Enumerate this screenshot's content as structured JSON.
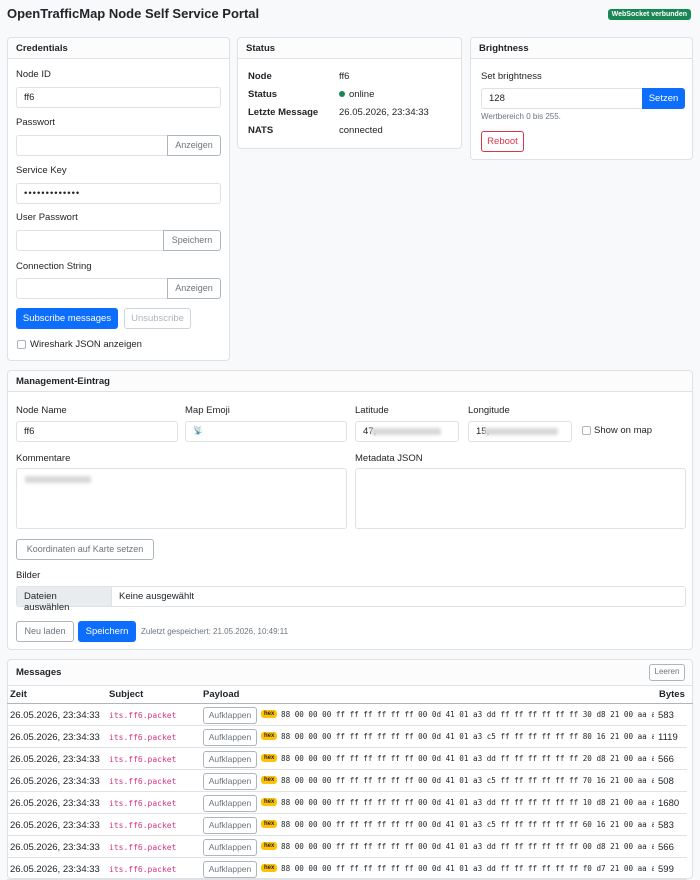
{
  "app": {
    "title": "OpenTrafficMap Node Self Service Portal",
    "ws_badge": "WebSocket verbunden"
  },
  "credentials": {
    "header": "Credentials",
    "node_id_label": "Node ID",
    "node_id_value": "ff6",
    "password_label": "Passwort",
    "password_toggle": "Anzeigen",
    "service_key_label": "Service Key",
    "service_key_value": "•••••••••••••",
    "user_password_label": "User Passwort",
    "user_password_save": "Speichern",
    "connection_string_label": "Connection String",
    "connection_string_toggle": "Anzeigen",
    "subscribe_label": "Subscribe messages",
    "unsubscribe_label": "Unsubscribe",
    "wireshark_label": "Wireshark JSON anzeigen"
  },
  "status": {
    "header": "Status",
    "rows": [
      {
        "key": "Node",
        "value": "ff6"
      },
      {
        "key": "Status",
        "value": "online"
      },
      {
        "key": "Letzte Message",
        "value": "26.05.2026, 23:34:33"
      },
      {
        "key": "NATS",
        "value": "connected"
      }
    ],
    "online_color": "#198754"
  },
  "brightness": {
    "header": "Brightness",
    "set_label": "Set brightness",
    "value": "128",
    "set_button": "Setzen",
    "hint": "Wertbereich 0 bis 255.",
    "reboot_button": "Reboot"
  },
  "management": {
    "header": "Management-Eintrag",
    "node_name_label": "Node Name",
    "node_name_value": "ff6",
    "emoji_label": "Map Emoji",
    "emoji_value": "📡",
    "lat_label": "Latitude",
    "lat_value": "47,",
    "lon_label": "Longitude",
    "lon_value": "15,",
    "show_on_map_label": "Show on map",
    "comments_label": "Kommentare",
    "metadata_label": "Metadata JSON",
    "set_coords_button": "Koordinaten auf Karte setzen",
    "images_label": "Bilder",
    "file_choose_button": "Dateien auswählen",
    "file_none": "Keine ausgewählt",
    "reload_button": "Neu laden",
    "save_button": "Speichern",
    "last_saved": "Zuletzt gespeichert: 21.05.2026, 10:49:11"
  },
  "messages": {
    "header": "Messages",
    "clear_button": "Leeren",
    "columns": [
      "Zeit",
      "Subject",
      "Payload",
      "Bytes"
    ],
    "expand_label": "Aufklappen",
    "hex_badge": "hex",
    "rows": [
      {
        "time": "26.05.2026, 23:34:33",
        "subject": "its.ff6.packet",
        "payload": "88 00 00 00 ff ff ff ff ff ff 00 0d 41 01 a3 dd ff ff ff ff ff ff 30 d8 21 00 aa aa …",
        "bytes": "583"
      },
      {
        "time": "26.05.2026, 23:34:33",
        "subject": "its.ff6.packet",
        "payload": "88 00 00 00 ff ff ff ff ff ff 00 0d 41 01 a3 c5 ff ff ff ff ff ff 80 16 21 00 aa aa …",
        "bytes": "1119"
      },
      {
        "time": "26.05.2026, 23:34:33",
        "subject": "its.ff6.packet",
        "payload": "88 00 00 00 ff ff ff ff ff ff 00 0d 41 01 a3 dd ff ff ff ff ff ff 20 d8 21 00 aa aa …",
        "bytes": "566"
      },
      {
        "time": "26.05.2026, 23:34:33",
        "subject": "its.ff6.packet",
        "payload": "88 00 00 00 ff ff ff ff ff ff 00 0d 41 01 a3 c5 ff ff ff ff ff ff 70 16 21 00 aa aa …",
        "bytes": "508"
      },
      {
        "time": "26.05.2026, 23:34:33",
        "subject": "its.ff6.packet",
        "payload": "88 00 00 00 ff ff ff ff ff ff 00 0d 41 01 a3 dd ff ff ff ff ff ff 10 d8 21 00 aa aa …",
        "bytes": "1680"
      },
      {
        "time": "26.05.2026, 23:34:33",
        "subject": "its.ff6.packet",
        "payload": "88 00 00 00 ff ff ff ff ff ff 00 0d 41 01 a3 c5 ff ff ff ff ff ff 60 16 21 00 aa aa …",
        "bytes": "583"
      },
      {
        "time": "26.05.2026, 23:34:33",
        "subject": "its.ff6.packet",
        "payload": "88 00 00 00 ff ff ff ff ff ff 00 0d 41 01 a3 dd ff ff ff ff ff ff 00 d8 21 00 aa aa …",
        "bytes": "566"
      },
      {
        "time": "26.05.2026, 23:34:33",
        "subject": "its.ff6.packet",
        "payload": "88 00 00 00 ff ff ff ff ff ff 00 0d 41 01 a3 dd ff ff ff ff ff ff f0 d7 21 00 aa aa …",
        "bytes": "599"
      }
    ]
  }
}
